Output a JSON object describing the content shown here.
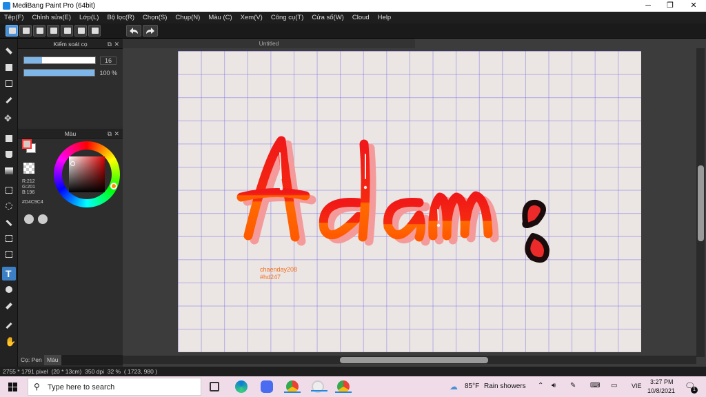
{
  "window": {
    "title": "MediBang Paint Pro (64bit)",
    "minimize": "─",
    "maximize": "❐",
    "close": "✕"
  },
  "menu": [
    "Tệp(F)",
    "Chỉnh sửa(E)",
    "Lớp(L)",
    "Bộ lọc(R)",
    "Chọn(S)",
    "Chụp(N)",
    "Màu (C)",
    "Xem(V)",
    "Công cụ(T)",
    "Cửa sổ(W)",
    "Cloud",
    "Help"
  ],
  "brush_panel": {
    "title": "Kiểm soát cọ",
    "size": {
      "value": "16",
      "level": 0.25
    },
    "opacity": {
      "value": "100 %",
      "level": 1.0
    }
  },
  "color_panel": {
    "title": "Màu",
    "r": "R:212",
    "g": "G:201",
    "b": "B:196",
    "hex": "#D4C9C4"
  },
  "panel_tabs": {
    "brush": "Cọ: Pen",
    "color": "Màu"
  },
  "document": {
    "tab_title": "Untitled",
    "credit_line1": "chaenday208",
    "credit_line2": "#hd247"
  },
  "status": {
    "size": "2755 * 1791 pixel",
    "physical": "(20 * 13cm)",
    "dpi": "350 dpi",
    "zoom": "32 %",
    "cursor": "( 1723, 980 )"
  },
  "taskbar": {
    "search_placeholder": "Type here to search",
    "weather_temp": "85°F",
    "weather_text": "Rain showers",
    "lang": "VIE",
    "time": "3:27 PM",
    "date": "10/8/2021",
    "notif_count": "1"
  },
  "colors": {
    "accent": "#3d7fc4",
    "fg_color": "#D4C9C4",
    "lettering_top": "#f01818",
    "lettering_bottom": "#ff6a00",
    "shadow": "#f59a9a"
  }
}
